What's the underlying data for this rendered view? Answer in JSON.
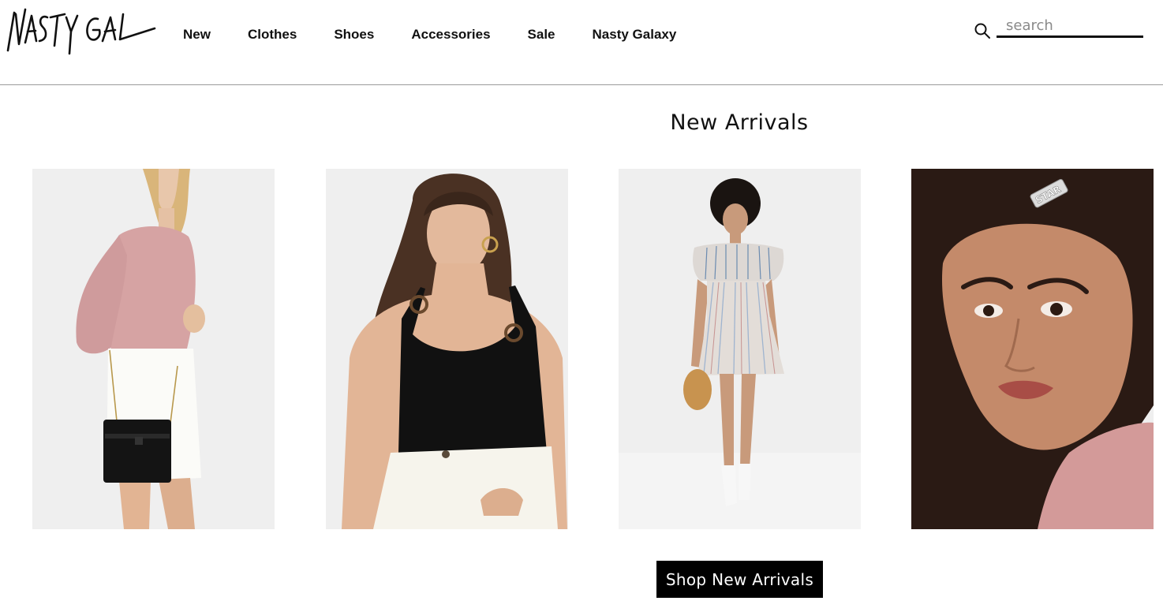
{
  "header": {
    "logo_text": "NASTY GAL",
    "nav": [
      {
        "label": "New"
      },
      {
        "label": "Clothes"
      },
      {
        "label": "Shoes"
      },
      {
        "label": "Accessories"
      },
      {
        "label": "Sale"
      },
      {
        "label": "Nasty Galaxy"
      }
    ],
    "search": {
      "placeholder": "search",
      "value": ""
    }
  },
  "main": {
    "title": "New Arrivals",
    "products": [
      {
        "icon": "pink-cardigan-photo"
      },
      {
        "icon": "black-tank-photo"
      },
      {
        "icon": "striped-dress-photo"
      },
      {
        "icon": "star-hair-clip-photo"
      }
    ],
    "cta_label": "Shop New Arrivals"
  },
  "colors": {
    "accent": "#000000",
    "border": "#9a9a9a",
    "photo_bg": "#efefef"
  }
}
